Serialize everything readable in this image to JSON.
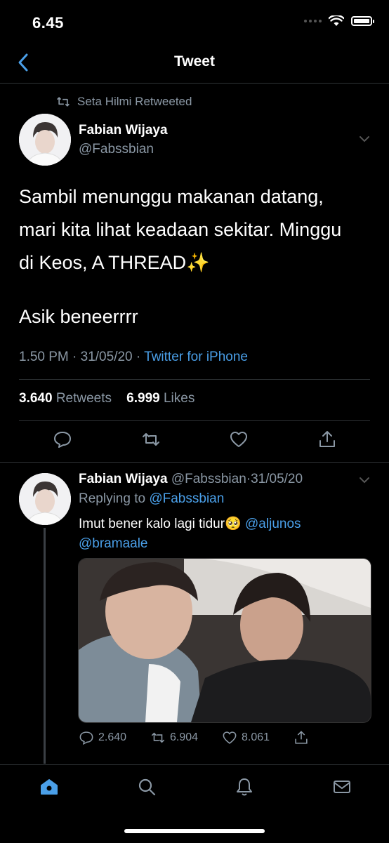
{
  "status_bar": {
    "time": "6.45"
  },
  "header": {
    "title": "Tweet",
    "back_icon": "chevron-left-icon"
  },
  "retweet_notice": "Seta Hilmi Retweeted",
  "main_tweet": {
    "author_name": "Fabian Wijaya",
    "author_handle": "@Fabssbian",
    "text": "Sambil menunggu makanan datang,\nmari kita lihat keadaan sekitar. Minggu\ndi Keos, A THREAD",
    "emoji": "✨",
    "text2": "Asik beneerrrr",
    "time": "1.50 PM · 31/05/20 · ",
    "source": "Twitter for iPhone",
    "retweets_count": "3.640",
    "retweets_label": "Retweets",
    "likes_count": "6.999",
    "likes_label": "Likes"
  },
  "reply_tweet": {
    "author_name": "Fabian Wijaya",
    "author_handle": "@Fabssbian",
    "date": "·31/05/20",
    "replying_label": "Replying to ",
    "replying_to": "@Fabssbian",
    "text": "Imut bener kalo lagi tidur",
    "emoji": "🥺",
    "mention1": "@aljunos",
    "mention2": "@bramaale",
    "replies": "2.640",
    "retweets": "6.904",
    "likes": "8.061"
  },
  "colors": {
    "accent": "#4a9fe8",
    "muted": "#8b98a5",
    "background": "#000000"
  },
  "tabbar": {
    "items": [
      "home-icon",
      "search-icon",
      "bell-icon",
      "mail-icon"
    ]
  }
}
